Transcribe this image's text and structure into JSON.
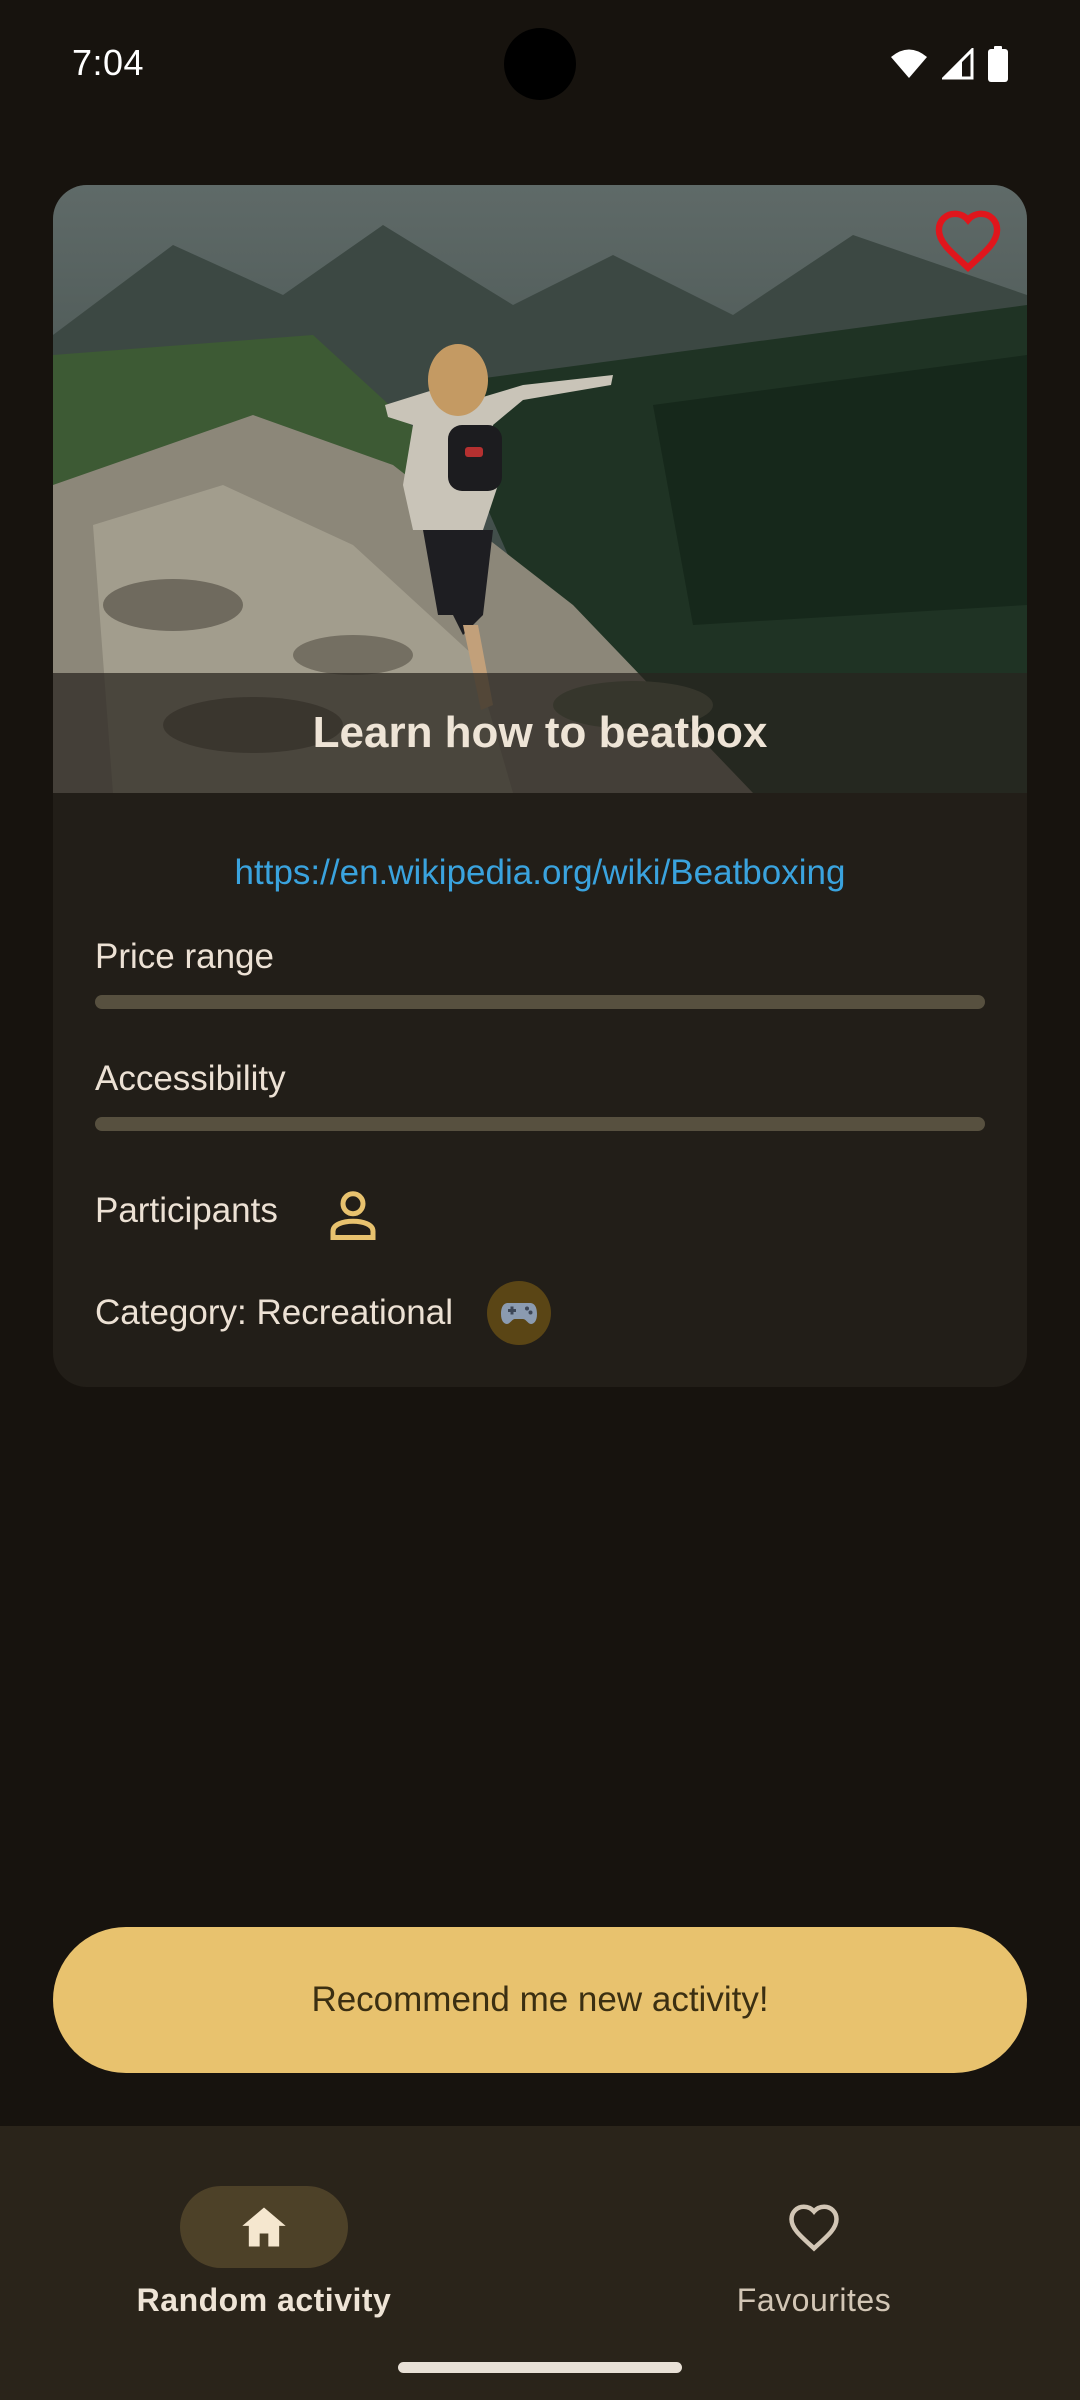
{
  "status_bar": {
    "time": "7:04",
    "icons": [
      "wifi-icon",
      "signal-icon",
      "battery-icon"
    ]
  },
  "activity": {
    "title": "Learn how to beatbox",
    "link": "https://en.wikipedia.org/wiki/Beatboxing",
    "favourite_icon": "heart-outline-icon",
    "price_range": {
      "label": "Price range",
      "level": 0
    },
    "accessibility": {
      "label": "Accessibility",
      "level": 0
    },
    "participants": {
      "label": "Participants",
      "count": 1,
      "icon": "person-icon"
    },
    "category": {
      "label": "Category: Recreational",
      "icon": "gamepad-icon"
    }
  },
  "actions": {
    "recommend_label": "Recommend me new activity!"
  },
  "bottom_nav": {
    "items": [
      {
        "label": "Random activity",
        "icon": "home-icon",
        "selected": true
      },
      {
        "label": "Favourites",
        "icon": "heart-outline-icon",
        "selected": false
      }
    ]
  },
  "colors": {
    "background": "#17130e",
    "card": "#221e18",
    "accent": "#e8c26e",
    "link": "#3aa3de",
    "heart": "#e0161c"
  }
}
